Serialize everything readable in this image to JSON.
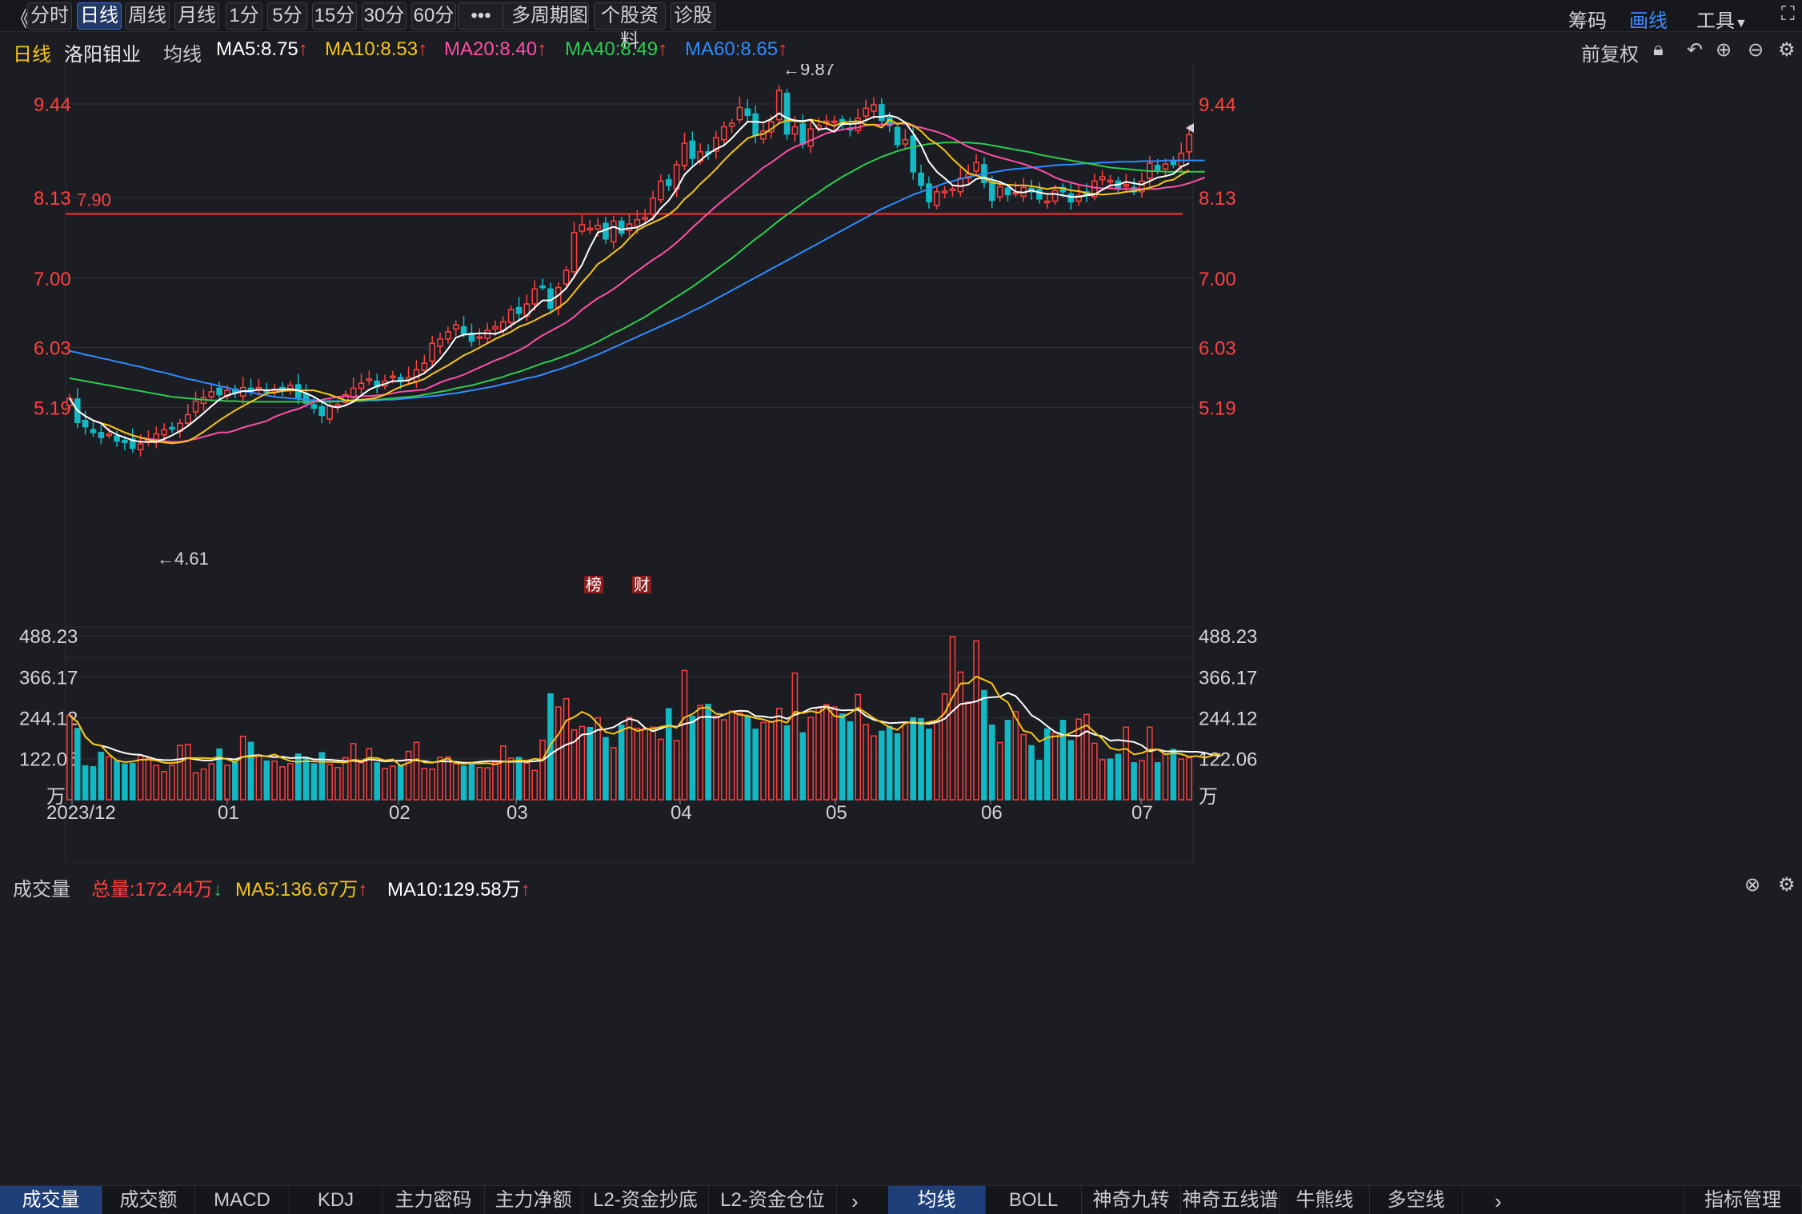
{
  "toolbar": {
    "collapse": "《",
    "periods": [
      "分时",
      "日线",
      "周线",
      "月线",
      "1分",
      "5分",
      "15分",
      "30分",
      "60分"
    ],
    "active_period": "日线",
    "more": "•••",
    "multi": "多周期图",
    "profile": "个股资料",
    "diagnose": "诊股",
    "chips": "筹码",
    "draw": "画线",
    "tools": "工具"
  },
  "stock": {
    "period": "日线",
    "name": "洛阳钼业"
  },
  "ma_header": {
    "label": "均线",
    "ma5": "MA5:8.75",
    "ma10": "MA10:8.53",
    "ma20": "MA20:8.40",
    "ma40": "MA40:8.49",
    "ma60": "MA60:8.65",
    "fuquan": "前复权"
  },
  "price_axis": [
    "9.44",
    "8.13",
    "7.00",
    "6.03",
    "5.19"
  ],
  "annotations": {
    "high": "←9.87",
    "low": "←4.61",
    "line": "7.90",
    "tag1": "榜",
    "tag2": "财"
  },
  "volume_header": {
    "label": "成交量",
    "total": "总量:172.44万",
    "ma5": "MA5:136.67万",
    "ma10": "MA10:129.58万"
  },
  "volume_axis": [
    "488.23",
    "366.17",
    "244.12",
    "122.06",
    "万"
  ],
  "date_axis": [
    "2023/12",
    "01",
    "02",
    "03",
    "04",
    "05",
    "06",
    "07"
  ],
  "bottom_tabs_left": [
    "成交量",
    "成交额",
    "MACD",
    "KDJ",
    "主力密码",
    "主力净额",
    "L2-资金抄底",
    "L2-资金仓位"
  ],
  "bottom_tabs_right": [
    "均线",
    "BOLL",
    "神奇九转",
    "神奇五线谱",
    "牛熊线",
    "多空线"
  ],
  "bottom_manage": "指标管理",
  "colors": {
    "up": "#ff4040",
    "down": "#12b8c4",
    "ma5": "#ffffff",
    "ma10": "#f5c518",
    "ma20": "#ff4fa8",
    "ma40": "#2ecc52",
    "ma60": "#2f8bff"
  },
  "chart_data": {
    "type": "candlestick",
    "close": [
      5.32,
      4.98,
      4.92,
      4.84,
      4.77,
      4.82,
      4.72,
      4.7,
      4.62,
      4.68,
      4.75,
      4.82,
      4.88,
      4.9,
      4.97,
      5.09,
      5.28,
      5.33,
      5.41,
      5.37,
      5.43,
      5.4,
      5.47,
      5.42,
      5.47,
      5.41,
      5.43,
      5.46,
      5.5,
      5.33,
      5.25,
      5.18,
      5.08,
      5.22,
      5.23,
      5.37,
      5.46,
      5.53,
      5.59,
      5.48,
      5.56,
      5.63,
      5.56,
      5.61,
      5.72,
      5.81,
      6.09,
      6.15,
      6.25,
      6.35,
      6.22,
      6.12,
      6.18,
      6.27,
      6.32,
      6.39,
      6.56,
      6.51,
      6.64,
      6.85,
      6.88,
      6.58,
      6.87,
      7.11,
      7.64,
      7.75,
      7.7,
      7.74,
      7.55,
      7.8,
      7.63,
      7.76,
      7.82,
      7.85,
      8.12,
      8.36,
      8.3,
      8.59,
      8.89,
      8.68,
      8.77,
      8.74,
      8.97,
      9.12,
      9.17,
      9.39,
      9.28,
      9.0,
      9.06,
      9.19,
      9.63,
      9.02,
      9.12,
      8.88,
      9.09,
      9.14,
      9.2,
      9.2,
      9.15,
      9.08,
      9.24,
      9.38,
      9.43,
      9.21,
      9.14,
      8.87,
      8.94,
      8.49,
      8.3,
      8.07,
      8.21,
      8.22,
      8.25,
      8.4,
      8.46,
      8.62,
      8.34,
      8.09,
      8.28,
      8.17,
      8.2,
      8.27,
      8.21,
      8.11,
      8.08,
      8.23,
      8.21,
      8.07,
      8.16,
      8.16,
      8.36,
      8.42,
      8.37,
      8.26,
      8.31,
      8.21,
      8.36,
      8.61,
      8.52,
      8.6,
      8.59,
      8.75,
      9.01
    ],
    "volume": [
      251,
      212,
      101,
      98,
      141,
      128,
      116,
      106,
      108,
      131,
      124,
      102,
      84,
      102,
      162,
      165,
      80,
      91,
      107,
      151,
      103,
      110,
      189,
      171,
      133,
      115,
      115,
      98,
      107,
      136,
      123,
      107,
      140,
      105,
      96,
      125,
      167,
      110,
      152,
      110,
      93,
      100,
      102,
      144,
      171,
      93,
      91,
      126,
      127,
      108,
      100,
      111,
      96,
      95,
      111,
      160,
      124,
      126,
      109,
      87,
      177,
      315,
      276,
      301,
      208,
      218,
      215,
      244,
      185,
      155,
      222,
      245,
      213,
      212,
      216,
      180,
      271,
      176,
      385,
      248,
      281,
      284,
      249,
      238,
      264,
      258,
      249,
      210,
      230,
      232,
      272,
      220,
      377,
      199,
      245,
      274,
      283,
      276,
      255,
      232,
      313,
      224,
      190,
      204,
      218,
      196,
      230,
      244,
      241,
      210,
      235,
      315,
      485,
      380,
      291,
      473,
      325,
      222,
      170,
      236,
      262,
      194,
      161,
      117,
      211,
      199,
      236,
      176,
      240,
      254,
      168,
      119,
      121,
      135,
      216,
      110,
      116,
      216,
      110,
      136,
      150,
      121,
      125,
      183,
      108,
      109,
      171,
      186
    ],
    "ma5": [
      5.32,
      5.15,
      5.07,
      5.01,
      4.97,
      4.87,
      4.81,
      4.77,
      4.73,
      4.71,
      4.71,
      4.71,
      4.75,
      4.8,
      4.86,
      4.93,
      5.02,
      5.11,
      5.21,
      5.3,
      5.36,
      5.39,
      5.42,
      5.42,
      5.44,
      5.43,
      5.44,
      5.44,
      5.45,
      5.43,
      5.39,
      5.34,
      5.27,
      5.21,
      5.19,
      5.22,
      5.27,
      5.36,
      5.44,
      5.49,
      5.52,
      5.56,
      5.56,
      5.57,
      5.62,
      5.67,
      5.76,
      5.87,
      6.01,
      6.17,
      6.21,
      6.22,
      6.23,
      6.23,
      6.22,
      6.26,
      6.34,
      6.41,
      6.48,
      6.59,
      6.69,
      6.69,
      6.76,
      6.86,
      7.02,
      7.19,
      7.43,
      7.64,
      7.68,
      7.72,
      7.68,
      7.7,
      7.71,
      7.77,
      7.84,
      7.98,
      8.09,
      8.25,
      8.45,
      8.56,
      8.65,
      8.74,
      8.81,
      8.86,
      8.96,
      9.08,
      9.19,
      9.19,
      9.18,
      9.23,
      9.31,
      9.24,
      9.21,
      9.2,
      9.22,
      9.08,
      9.1,
      9.05,
      9.16,
      9.16,
      9.17,
      9.21,
      9.26,
      9.26,
      9.28,
      9.25,
      9.18,
      9.03,
      8.86,
      8.63,
      8.49,
      8.4,
      8.3,
      8.29,
      8.31,
      8.39,
      8.41,
      8.38,
      8.35,
      8.3,
      8.21,
      8.2,
      8.23,
      8.2,
      8.18,
      8.18,
      8.16,
      8.14,
      8.14,
      8.16,
      8.17,
      8.24,
      8.3,
      8.31,
      8.35,
      8.33,
      8.31,
      8.36,
      8.41,
      8.43,
      8.46,
      8.56,
      8.61
    ],
    "ma10": [
      5.32,
      5.15,
      5.07,
      5.01,
      4.97,
      4.94,
      4.89,
      4.84,
      4.8,
      4.77,
      4.74,
      4.72,
      4.7,
      4.69,
      4.7,
      4.72,
      4.78,
      4.85,
      4.93,
      5.01,
      5.08,
      5.15,
      5.21,
      5.27,
      5.33,
      5.39,
      5.4,
      5.42,
      5.43,
      5.43,
      5.43,
      5.43,
      5.4,
      5.37,
      5.33,
      5.29,
      5.29,
      5.3,
      5.31,
      5.33,
      5.37,
      5.43,
      5.48,
      5.52,
      5.55,
      5.59,
      5.66,
      5.72,
      5.78,
      5.85,
      5.92,
      5.97,
      6.03,
      6.09,
      6.15,
      6.2,
      6.25,
      6.32,
      6.36,
      6.41,
      6.47,
      6.52,
      6.59,
      6.67,
      6.8,
      6.94,
      7.06,
      7.2,
      7.27,
      7.36,
      7.44,
      7.56,
      7.67,
      7.73,
      7.78,
      7.83,
      7.89,
      7.98,
      8.11,
      8.2,
      8.32,
      8.42,
      8.53,
      8.65,
      8.76,
      8.86,
      8.96,
      9.0,
      9.02,
      9.09,
      9.17,
      9.21,
      9.2,
      9.19,
      9.22,
      9.2,
      9.17,
      9.13,
      9.18,
      9.19,
      9.2,
      9.15,
      9.15,
      9.11,
      9.22,
      9.16,
      9.18,
      9.14,
      9.06,
      8.95,
      8.88,
      8.79,
      8.67,
      8.57,
      8.47,
      8.44,
      8.4,
      8.34,
      8.32,
      8.31,
      8.3,
      8.3,
      8.29,
      8.27,
      8.25,
      8.27,
      8.26,
      8.23,
      8.22,
      8.19,
      8.18,
      8.17,
      8.18,
      8.19,
      8.21,
      8.22,
      8.24,
      8.27,
      8.3,
      8.36,
      8.38,
      8.45,
      8.51
    ],
    "ma20": [
      5.32,
      5.15,
      5.07,
      5.01,
      4.97,
      4.94,
      4.89,
      4.84,
      4.8,
      4.77,
      4.75,
      4.74,
      4.72,
      4.71,
      4.71,
      4.73,
      4.75,
      4.78,
      4.81,
      4.84,
      4.84,
      4.87,
      4.91,
      4.94,
      4.97,
      5.0,
      5.06,
      5.1,
      5.14,
      5.17,
      5.22,
      5.27,
      5.3,
      5.32,
      5.34,
      5.35,
      5.34,
      5.35,
      5.35,
      5.36,
      5.37,
      5.39,
      5.41,
      5.42,
      5.43,
      5.44,
      5.49,
      5.54,
      5.58,
      5.61,
      5.65,
      5.7,
      5.75,
      5.8,
      5.85,
      5.89,
      5.94,
      5.99,
      6.05,
      6.13,
      6.2,
      6.26,
      6.32,
      6.38,
      6.46,
      6.56,
      6.64,
      6.72,
      6.78,
      6.85,
      6.93,
      7.02,
      7.1,
      7.18,
      7.26,
      7.33,
      7.41,
      7.5,
      7.6,
      7.71,
      7.81,
      7.91,
      8.01,
      8.1,
      8.19,
      8.28,
      8.37,
      8.46,
      8.55,
      8.62,
      8.7,
      8.78,
      8.84,
      8.88,
      8.93,
      8.98,
      9.03,
      9.06,
      9.08,
      9.1,
      9.11,
      9.14,
      9.15,
      9.15,
      9.16,
      9.17,
      9.16,
      9.13,
      9.11,
      9.08,
      9.05,
      9.01,
      8.96,
      8.9,
      8.84,
      8.8,
      8.76,
      8.72,
      8.69,
      8.66,
      8.63,
      8.6,
      8.56,
      8.52,
      8.47,
      8.41,
      8.37,
      8.34,
      8.31,
      8.29,
      8.27,
      8.26,
      8.26,
      8.25,
      8.25,
      8.25,
      8.25,
      8.25,
      8.25,
      8.27,
      8.28,
      8.3,
      8.33,
      8.37,
      8.41
    ],
    "ma40": [
      5.6,
      5.58,
      5.56,
      5.54,
      5.52,
      5.5,
      5.48,
      5.46,
      5.44,
      5.42,
      5.4,
      5.38,
      5.36,
      5.34,
      5.33,
      5.32,
      5.31,
      5.3,
      5.29,
      5.29,
      5.28,
      5.28,
      5.27,
      5.27,
      5.27,
      5.27,
      5.27,
      5.27,
      5.27,
      5.27,
      5.27,
      5.27,
      5.27,
      5.27,
      5.27,
      5.28,
      5.28,
      5.29,
      5.3,
      5.3,
      5.31,
      5.32,
      5.33,
      5.34,
      5.35,
      5.37,
      5.39,
      5.41,
      5.43,
      5.46,
      5.48,
      5.5,
      5.53,
      5.56,
      5.59,
      5.62,
      5.66,
      5.69,
      5.73,
      5.77,
      5.81,
      5.84,
      5.88,
      5.92,
      5.96,
      6.01,
      6.06,
      6.11,
      6.17,
      6.23,
      6.28,
      6.34,
      6.4,
      6.46,
      6.53,
      6.6,
      6.67,
      6.74,
      6.81,
      6.88,
      6.96,
      7.04,
      7.12,
      7.2,
      7.28,
      7.37,
      7.46,
      7.55,
      7.63,
      7.72,
      7.81,
      7.89,
      7.97,
      8.05,
      8.13,
      8.2,
      8.28,
      8.35,
      8.42,
      8.48,
      8.54,
      8.6,
      8.65,
      8.7,
      8.74,
      8.78,
      8.81,
      8.84,
      8.86,
      8.88,
      8.89,
      8.9,
      8.9,
      8.9,
      8.9,
      8.89,
      8.88,
      8.86,
      8.84,
      8.82,
      8.8,
      8.78,
      8.76,
      8.73,
      8.71,
      8.69,
      8.67,
      8.65,
      8.63,
      8.61,
      8.59,
      8.57,
      8.55,
      8.54,
      8.53,
      8.52,
      8.51,
      8.5,
      8.5,
      8.49,
      8.49,
      8.49,
      8.49,
      8.49,
      8.49
    ],
    "ma60": [
      5.98,
      5.96,
      5.93,
      5.91,
      5.88,
      5.86,
      5.83,
      5.81,
      5.78,
      5.76,
      5.73,
      5.7,
      5.68,
      5.65,
      5.62,
      5.59,
      5.57,
      5.54,
      5.52,
      5.49,
      5.47,
      5.44,
      5.42,
      5.4,
      5.38,
      5.36,
      5.34,
      5.33,
      5.32,
      5.31,
      5.3,
      5.29,
      5.28,
      5.28,
      5.28,
      5.28,
      5.28,
      5.28,
      5.29,
      5.29,
      5.3,
      5.3,
      5.31,
      5.32,
      5.33,
      5.34,
      5.35,
      5.36,
      5.38,
      5.39,
      5.41,
      5.43,
      5.45,
      5.47,
      5.49,
      5.52,
      5.54,
      5.57,
      5.6,
      5.62,
      5.65,
      5.69,
      5.72,
      5.76,
      5.8,
      5.84,
      5.89,
      5.93,
      5.98,
      6.03,
      6.08,
      6.13,
      6.18,
      6.23,
      6.28,
      6.33,
      6.38,
      6.43,
      6.48,
      6.54,
      6.59,
      6.65,
      6.71,
      6.77,
      6.83,
      6.89,
      6.95,
      7.01,
      7.07,
      7.13,
      7.19,
      7.25,
      7.31,
      7.37,
      7.43,
      7.49,
      7.55,
      7.61,
      7.67,
      7.73,
      7.79,
      7.85,
      7.91,
      7.97,
      8.02,
      8.07,
      8.12,
      8.17,
      8.21,
      8.25,
      8.29,
      8.33,
      8.36,
      8.39,
      8.42,
      8.44,
      8.46,
      8.48,
      8.5,
      8.52,
      8.53,
      8.54,
      8.55,
      8.56,
      8.57,
      8.58,
      8.59,
      8.59,
      8.6,
      8.61,
      8.61,
      8.62,
      8.62,
      8.63,
      8.63,
      8.63,
      8.64,
      8.64,
      8.64,
      8.65,
      8.65,
      8.65,
      8.65,
      8.65,
      8.65
    ],
    "vol_ma5": [
      251,
      232,
      188,
      166,
      161,
      136,
      117,
      112,
      114,
      119,
      120,
      117,
      110,
      109,
      113,
      124,
      124,
      124,
      123,
      127,
      120,
      112,
      128,
      128,
      131,
      129,
      135,
      124,
      115,
      113,
      115,
      114,
      113,
      113,
      112,
      111,
      119,
      116,
      125,
      124,
      117,
      120,
      101,
      110,
      121,
      111,
      110,
      116,
      123,
      109,
      107,
      109,
      108,
      109,
      105,
      113,
      115,
      117,
      116,
      122,
      119,
      164,
      194,
      236,
      246,
      262,
      251,
      226,
      202,
      196,
      207,
      216,
      205,
      210,
      211,
      217,
      221,
      214,
      245,
      255,
      273,
      275,
      256,
      254,
      262,
      253,
      250,
      243,
      239,
      231,
      237,
      229,
      262,
      258,
      264,
      259,
      276,
      249,
      246,
      258,
      274,
      259,
      243,
      230,
      216,
      208,
      228,
      233,
      225,
      231,
      236,
      258,
      306,
      346,
      347,
      367,
      357,
      346,
      305,
      290,
      244,
      205,
      199,
      173,
      185,
      189,
      190,
      199,
      211,
      222,
      202,
      181,
      154,
      148,
      152,
      135,
      139,
      149,
      150,
      135,
      139,
      136,
      128,
      130,
      125,
      132,
      137
    ],
    "vol_ma10": [
      251,
      232,
      188,
      166,
      161,
      155,
      146,
      139,
      135,
      134,
      127,
      120,
      118,
      118,
      121,
      124,
      120,
      117,
      117,
      123,
      122,
      120,
      128,
      131,
      133,
      129,
      127,
      128,
      124,
      125,
      126,
      120,
      120,
      119,
      117,
      115,
      116,
      113,
      120,
      118,
      114,
      116,
      116,
      119,
      117,
      115,
      111,
      114,
      114,
      113,
      110,
      110,
      113,
      115,
      115,
      114,
      113,
      114,
      113,
      115,
      117,
      136,
      151,
      164,
      172,
      194,
      196,
      208,
      210,
      216,
      230,
      241,
      235,
      214,
      204,
      212,
      221,
      217,
      226,
      231,
      246,
      247,
      244,
      253,
      262,
      265,
      264,
      249,
      248,
      244,
      249,
      241,
      253,
      260,
      272,
      275,
      278,
      270,
      266,
      267,
      268,
      250,
      238,
      233,
      228,
      229,
      231,
      229,
      228,
      226,
      231,
      241,
      264,
      285,
      288,
      293,
      303,
      305,
      307,
      318,
      309,
      282,
      252,
      238,
      219,
      202,
      193,
      191,
      190,
      204,
      194,
      189,
      176,
      178,
      175,
      172,
      162,
      144,
      150,
      144,
      144,
      144,
      143,
      143,
      140,
      133,
      130
    ]
  }
}
